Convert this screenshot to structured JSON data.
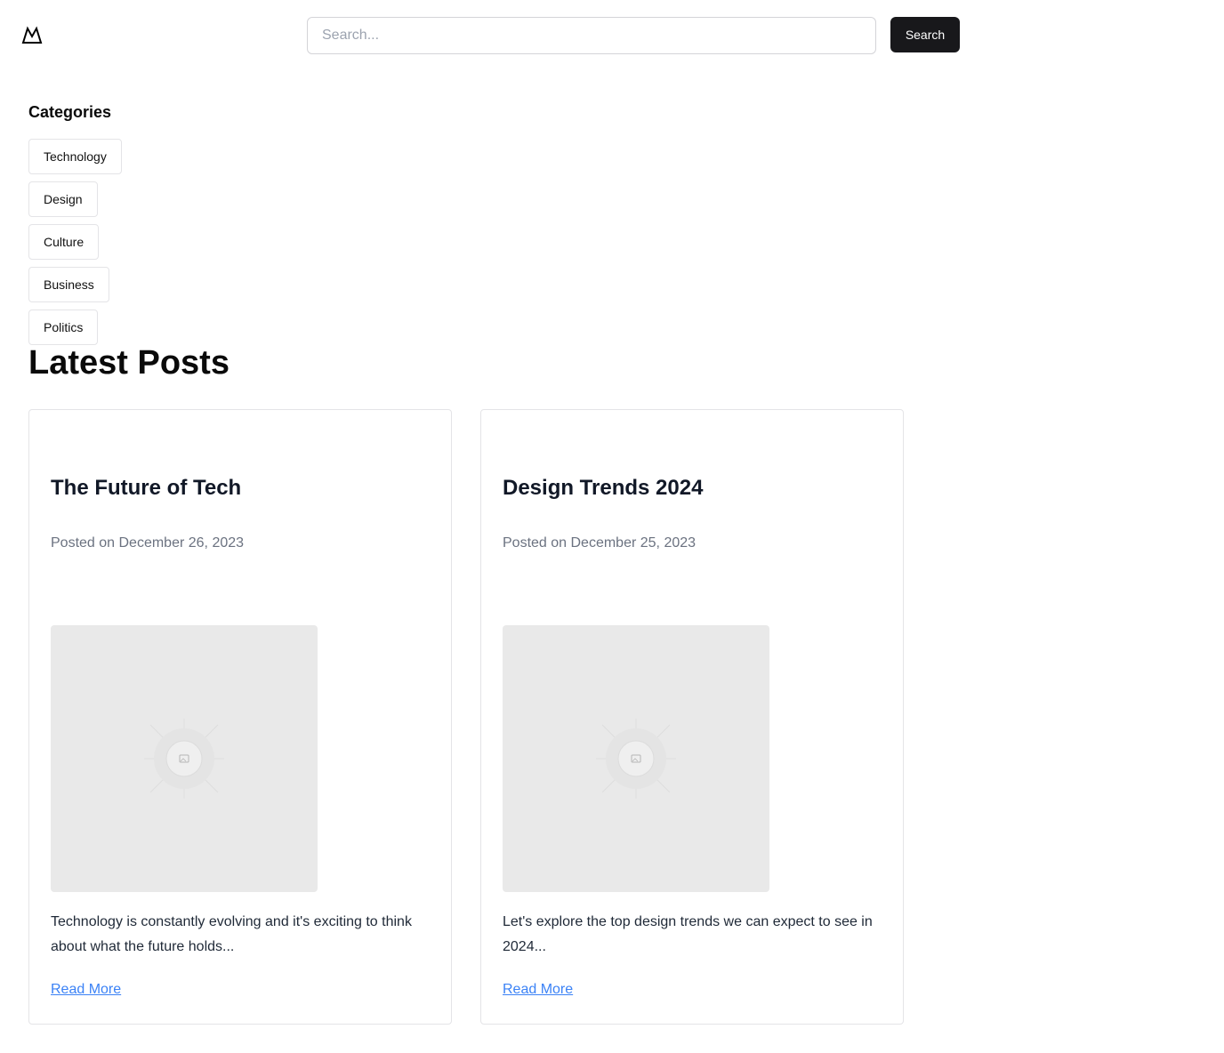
{
  "header": {
    "logo_icon": "mountain-logo-icon",
    "search": {
      "placeholder": "Search...",
      "value": "",
      "button_label": "Search"
    }
  },
  "categories": {
    "title": "Categories",
    "items": [
      {
        "label": "Technology"
      },
      {
        "label": "Design"
      },
      {
        "label": "Culture"
      },
      {
        "label": "Business"
      },
      {
        "label": "Politics"
      }
    ]
  },
  "latest_posts": {
    "title": "Latest Posts",
    "posts": [
      {
        "title": "The Future of Tech",
        "date": "Posted on December 26, 2023",
        "image_icon": "image-placeholder-icon",
        "excerpt": "Technology is constantly evolving and it's exciting to think about what the future holds...",
        "link_label": "Read More"
      },
      {
        "title": "Design Trends 2024",
        "date": "Posted on December 25, 2023",
        "image_icon": "image-placeholder-icon",
        "excerpt": "Let's explore the top design trends we can expect to see in 2024...",
        "link_label": "Read More"
      }
    ]
  },
  "colors": {
    "primary_button": "#18181b",
    "link": "#3b82f6",
    "muted_text": "#6b7280",
    "border": "#e4e4e7",
    "image_placeholder": "#e9e9e9"
  }
}
